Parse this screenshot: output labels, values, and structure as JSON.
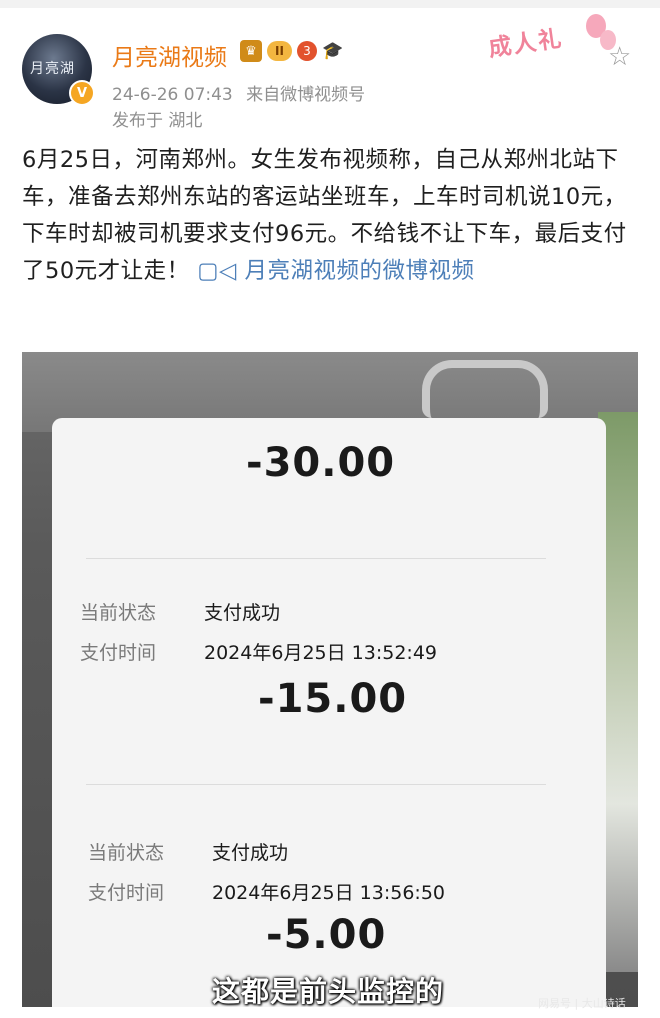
{
  "post": {
    "author": "月亮湖视频",
    "avatar_text": "月亮湖",
    "level_badge": "II",
    "timestamp": "24-6-26 07:43",
    "source": "来自微博视频号",
    "location": "发布于 湖北",
    "decoration": "成人礼",
    "body": "6月25日，河南郑州。女生发布视频称，自己从郑州北站下车，准备去郑州东站的客运站坐班车，上车时司机说10元，下车时却被司机要求支付96元。不给钱不让下车，最后支付了50元才让走！",
    "link_text": "月亮湖视频的微博视频",
    "link_icon": "video-icon"
  },
  "video": {
    "payments": [
      {
        "amount": "-30.00"
      },
      {
        "status_label": "当前状态",
        "status": "支付成功",
        "time_label": "支付时间",
        "time": "2024年6月25日 13:52:49",
        "amount": "-15.00"
      },
      {
        "status_label": "当前状态",
        "status": "支付成功",
        "time_label": "支付时间",
        "time": "2024年6月25日 13:56:50",
        "amount": "-5.00"
      }
    ],
    "subtitle": "这都是前头监控的"
  },
  "watermark": "网易号 | 大山诗话",
  "colors": {
    "author": "#ea7a17",
    "link": "#4d7fb8",
    "meta": "#8f8f8f"
  }
}
